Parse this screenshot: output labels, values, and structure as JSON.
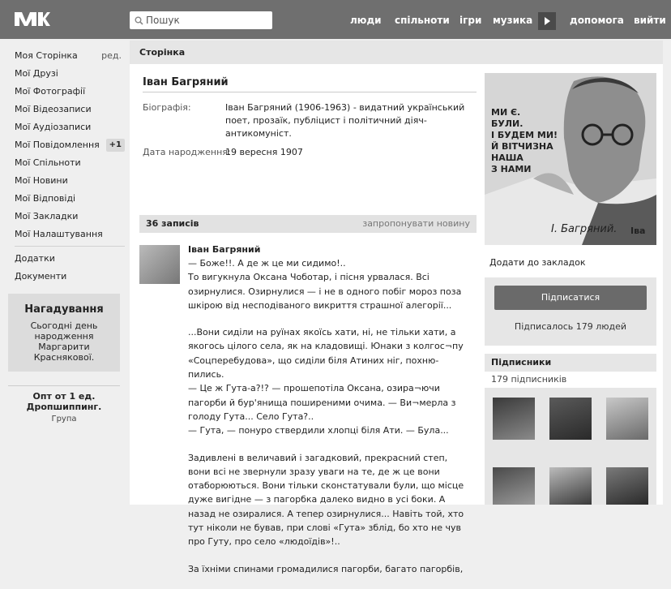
{
  "header": {
    "search_placeholder": "Пошук",
    "nav": [
      "люди",
      "спільноти",
      "ігри",
      "музика",
      "допомога",
      "вийти"
    ]
  },
  "leftnav": {
    "items": [
      {
        "label": "Моя Сторінка",
        "extra": "ред."
      },
      {
        "label": "Мої Друзі"
      },
      {
        "label": "Мої Фотографії"
      },
      {
        "label": "Мої Відеозаписи"
      },
      {
        "label": "Мої Аудіозаписи"
      },
      {
        "label": "Мої Повідомлення",
        "badge": "+1"
      },
      {
        "label": "Мої Спільноти"
      },
      {
        "label": "Мої Новини"
      },
      {
        "label": "Мої Відповіді"
      },
      {
        "label": "Мої Закладки"
      },
      {
        "label": "Мої Налаштування"
      }
    ],
    "extra_items": [
      "Додатки",
      "Документи"
    ]
  },
  "reminder": {
    "title": "Нагадування",
    "text": "Сьогодні день народження Маргарити Краснякової."
  },
  "promo": {
    "title": "Опт от 1 ед. Дропшиппинг.",
    "subtitle": "Група"
  },
  "page": {
    "header": "Сторінка",
    "name": "Іван Багряний",
    "bio_label": "Біографія:",
    "bio_value": "Іван Багряний (1906-1963) - видатний український поет, прозаїк, публіцист і політичний діяч-антикомуніст.",
    "birth_label": "Дата народження:",
    "birth_value": "19 вересня 1907"
  },
  "wall": {
    "count": "36 записів",
    "suggest": "запропонувати новину",
    "post": {
      "author": "Іван Багряний",
      "paragraphs": [
        "— Боже!!. А де ж це ми сидимо!..\nТо вигукнула Оксана Чоботар, і пісня урвалася. Всі озирнулися. Озирнулися — і не в одного побіг мороз поза шкірою від несподіваного викриття страшної алегорії...",
        "...Вони сиділи на руїнах якоїсь хати, ні, не тільки хати, а якогось цілого села, як на кладовищі. Юнаки з колгос¬пу «Соцперебудова», що сиділи біля Атиних ніг, похню-пились.\n— Це ж Гута-а?!? — прошепотіла Оксана, озира¬ючи пагорби й бур'янища поширеними очима. — Ви¬мерла з голоду Гута... Село Гута?..\n— Гута, — понуро ствердили хлопці біля Ати. — Була...",
        "Задивлені в величавий і загадковий, прекрасний степ, вони всі не звернули зразу уваги на те, де ж це вони отаборюються. Вони тільки сконстатували були, що місце дуже вигідне — з пагорбка далеко видно в усі боки. А назад не озиралися. А тепер озирнулися... Навіть той, хто тут ніколи не бував, при слові «Гута» зблід, бо хто не чув про Гуту, про село «людоїдів»!..",
        "За їхніми спинами громадилися пагорби, багато пагорбів,"
      ]
    }
  },
  "right": {
    "photo_text": "МИ Є.\nБУЛИ.\nІ БУДЕМ МИ!\nЙ ВІТЧИЗНА\nНАША\nЗ НАМИ",
    "photo_signature": "І. Багряний.",
    "photo_signature2": "Іва",
    "bookmark": "Додати до закладок",
    "subscribe_button": "Підписатися",
    "subscribed_count": "Підписалось 179 людей",
    "subscribers_title": "Підписники",
    "subscribers_count": "179 підписників"
  }
}
